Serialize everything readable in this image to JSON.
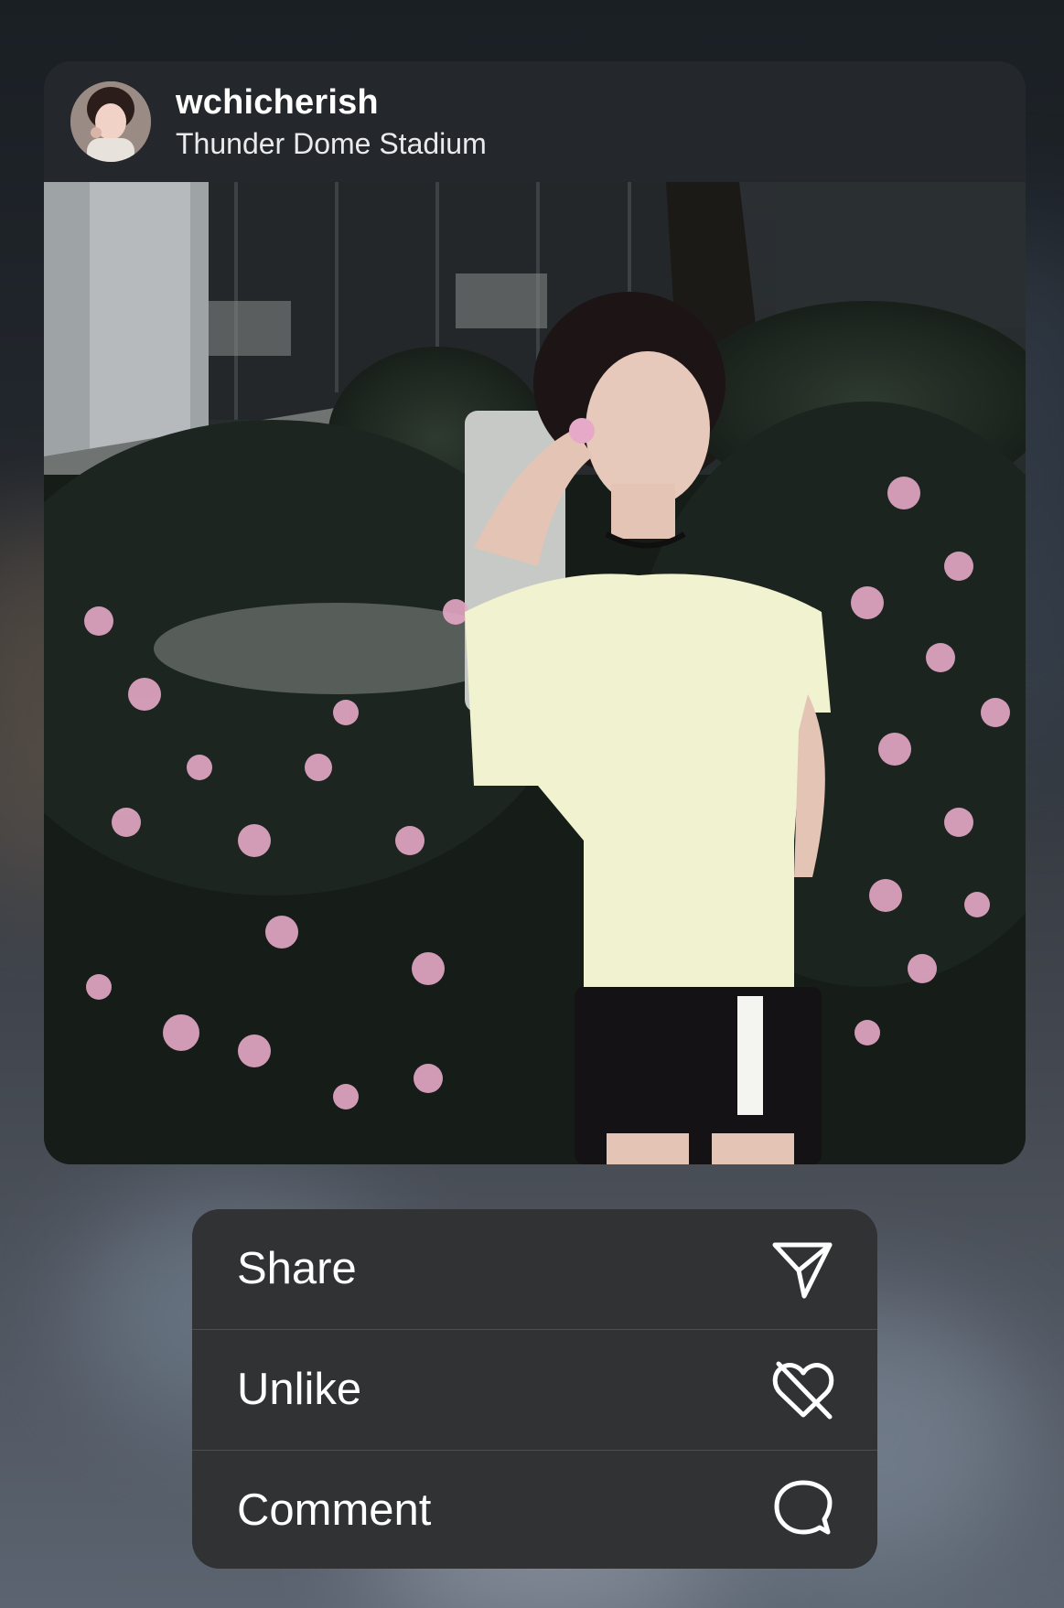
{
  "post": {
    "username": "wchicherish",
    "location": "Thunder Dome Stadium"
  },
  "menu": {
    "items": [
      {
        "label": "Share",
        "icon": "paper-plane-icon"
      },
      {
        "label": "Unlike",
        "icon": "heart-slash-icon"
      },
      {
        "label": "Comment",
        "icon": "speech-bubble-icon"
      }
    ]
  },
  "colors": {
    "card_background": "#24272c",
    "menu_background": "#303234",
    "text": "#ffffff"
  }
}
